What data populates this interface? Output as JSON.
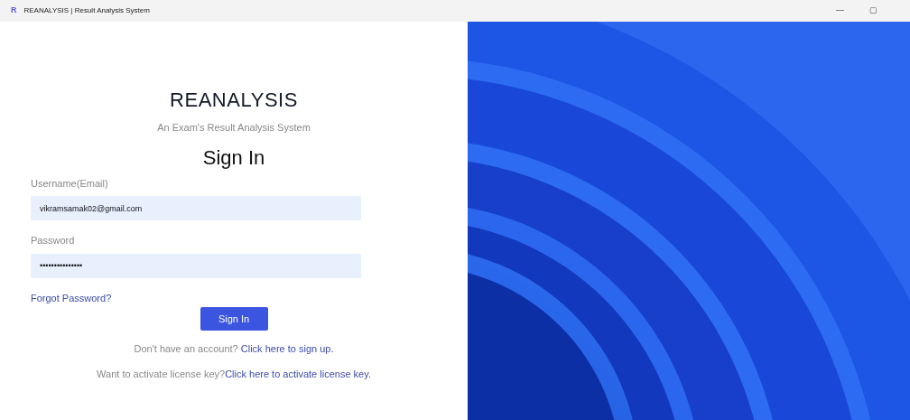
{
  "window": {
    "icon_letter": "R",
    "title": "REANALYSIS | Result Analysis System",
    "controls": [
      "—",
      "▢"
    ]
  },
  "app_name": "REANALYSIS",
  "tagline": "An Exam's Result Analysis System",
  "heading": "Sign In",
  "fields": [
    {
      "label": "Username(Email)",
      "value": "vikramsamak02@gmail.com"
    },
    {
      "label": "Password",
      "value": "•••••••••••••••"
    }
  ],
  "forgot_link": "Forgot Password?",
  "submit_button": "Sign In",
  "prompts": [
    {
      "text": "Don't have an account? ",
      "link": "Click here to sign up."
    },
    {
      "text": "Want to activate license key?",
      "link": "Click here to activate license key."
    }
  ]
}
